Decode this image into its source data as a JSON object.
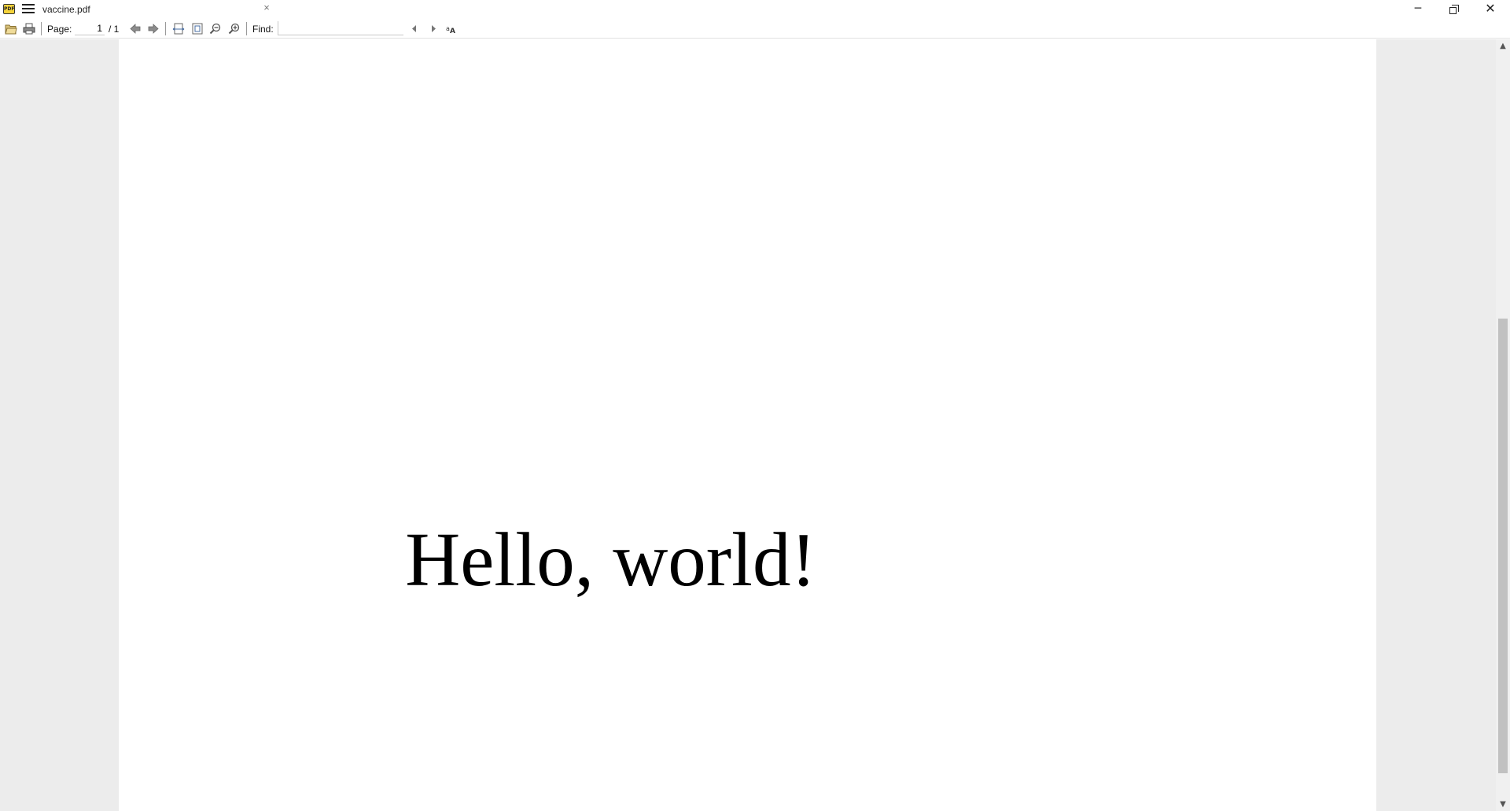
{
  "window": {
    "tab_title": "vaccine.pdf",
    "tab_close": "×",
    "minimize": "─",
    "close": "✕",
    "app_icon_text": "PDF"
  },
  "toolbar": {
    "page_label": "Page:",
    "page_current": "1",
    "page_total": "/ 1",
    "find_label": "Find:",
    "find_value": ""
  },
  "document": {
    "text": "Hello, world!"
  },
  "scrollbar": {
    "up": "▲",
    "down": "▼"
  }
}
